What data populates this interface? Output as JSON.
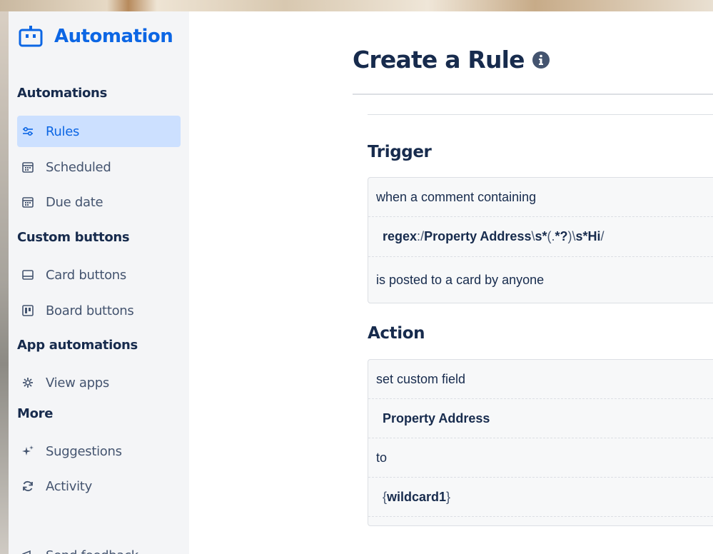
{
  "sidebar": {
    "brand": "Automation",
    "sections": {
      "automations": "Automations",
      "custom_buttons": "Custom buttons",
      "app_automations": "App automations",
      "more": "More"
    },
    "items": {
      "rules": "Rules",
      "scheduled": "Scheduled",
      "due_date": "Due date",
      "card_buttons": "Card buttons",
      "board_buttons": "Board buttons",
      "view_apps": "View apps",
      "suggestions": "Suggestions",
      "activity": "Activity",
      "send_feedback": "Send feedback"
    }
  },
  "main": {
    "title": "Create a Rule",
    "trigger": {
      "heading": "Trigger",
      "line1": "when a comment containing",
      "regex_keyword": "regex",
      "regex_colon": ":",
      "regex_slash_open": "/",
      "regex_part1": "Property Address",
      "regex_part2": "\\",
      "regex_part3": "s*",
      "regex_part4": "(.",
      "regex_part5": "*?",
      "regex_part6": ")\\",
      "regex_part7": "s*Hi",
      "regex_slash_close": "/",
      "line3": "is posted to a card by anyone"
    },
    "action": {
      "heading": "Action",
      "line1": "set custom field",
      "field": "Property Address",
      "line3": "to",
      "value_open": "{",
      "value": "wildcard1",
      "value_close": "}"
    }
  },
  "colors": {
    "accent": "#0c66e4",
    "active_bg": "#cce0ff",
    "text": "#172b4d"
  }
}
